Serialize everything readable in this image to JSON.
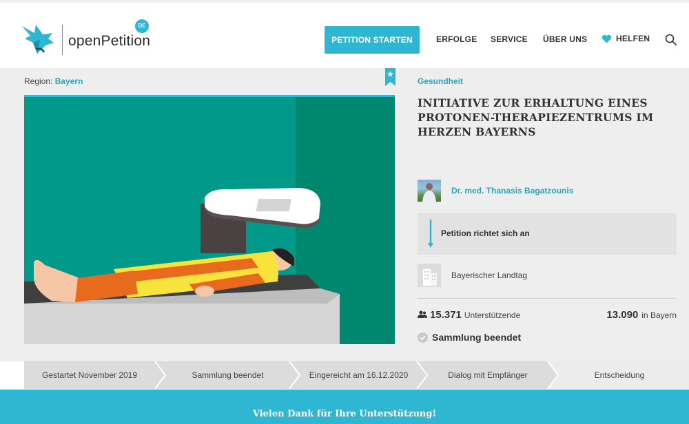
{
  "header": {
    "logo_text": "openPetition",
    "logo_badge": "DE",
    "start_button": "PETITION STARTEN",
    "nav": [
      "ERFOLGE",
      "SERVICE",
      "ÜBER UNS",
      "HELFEN"
    ],
    "icons": {
      "search": "search-icon",
      "heart": "heart-icon"
    },
    "accent_color": "#2fb6d0"
  },
  "petition": {
    "region_label": "Region:",
    "region_value": "Bayern",
    "category": "Gesundheit",
    "title": "INITIATIVE ZUR ERHALTUNG EINES PROTONEN-THERAPIEZENTRUMS IM HER­ZEN BAYERNS",
    "author": "Dr. med. Thanasis Bagatzounis",
    "recipient_label": "Petition richtet sich an",
    "recipient_name": "Bayerischer Landtag",
    "supporters_count": "15.371",
    "supporters_label": "Unterstützende",
    "bayern_count": "13.090",
    "bayern_label": "in Bayern",
    "status": "Sammlung beendet"
  },
  "steps": [
    "Gestartet November 2019",
    "Sammlung beendet",
    "Eingereicht am 16.12.2020",
    "Dialog mit Empfänger",
    "Entscheidung"
  ],
  "banner": {
    "text": "Vielen Dank für Ihre Unterstützung!"
  }
}
